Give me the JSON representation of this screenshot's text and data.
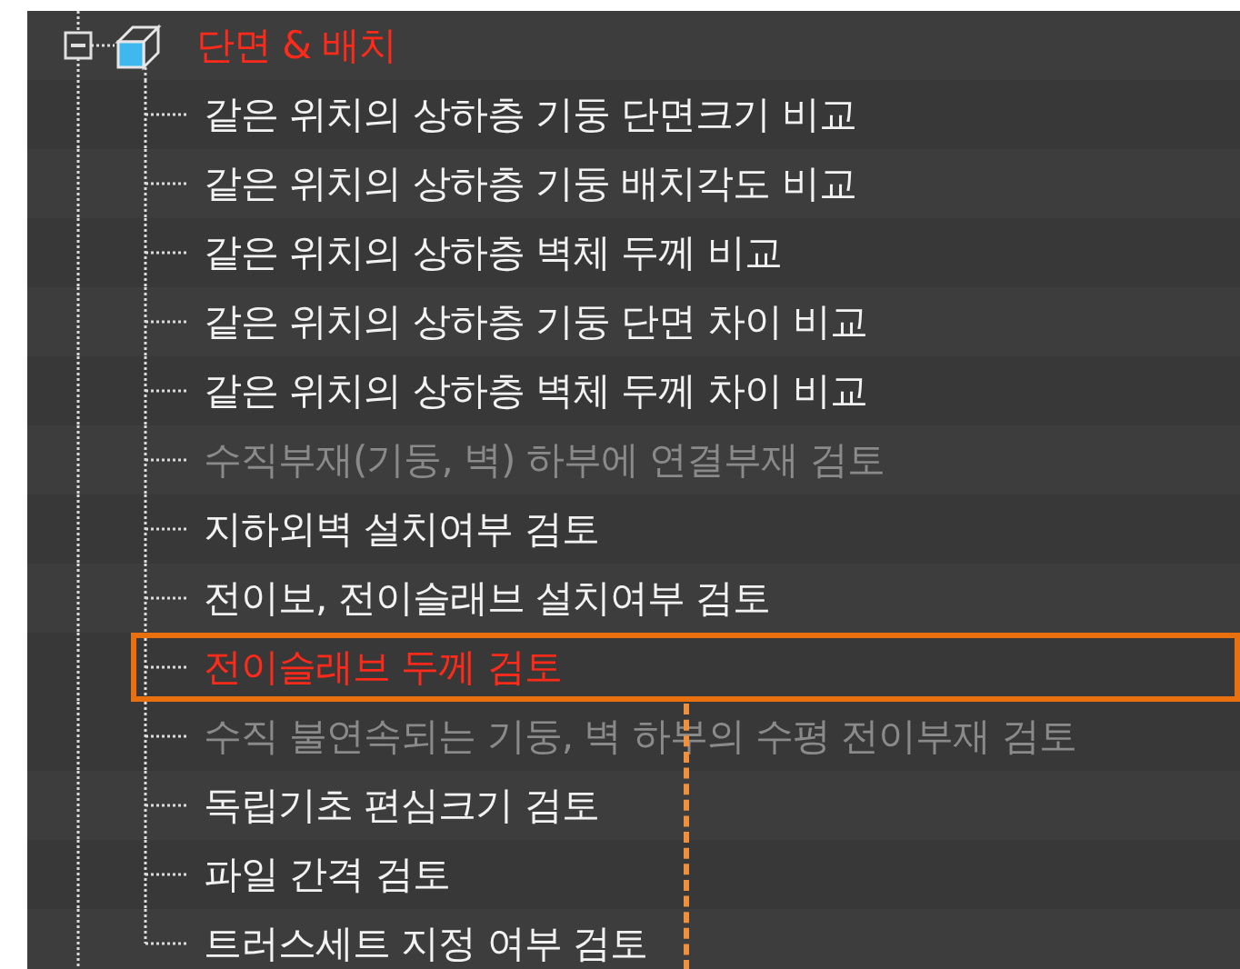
{
  "tree": {
    "label": "단면 & 배치",
    "expanded": true,
    "children": [
      {
        "label": "같은 위치의 상하층 기둥 단면크기 비교",
        "disabled": false,
        "highlighted": false
      },
      {
        "label": "같은 위치의 상하층 기둥 배치각도 비교",
        "disabled": false,
        "highlighted": false
      },
      {
        "label": "같은 위치의 상하층 벽체 두께 비교",
        "disabled": false,
        "highlighted": false
      },
      {
        "label": "같은 위치의 상하층 기둥 단면 차이 비교",
        "disabled": false,
        "highlighted": false
      },
      {
        "label": "같은 위치의 상하층 벽체 두께 차이 비교",
        "disabled": false,
        "highlighted": false
      },
      {
        "label": "수직부재(기둥, 벽) 하부에 연결부재 검토",
        "disabled": true,
        "highlighted": false
      },
      {
        "label": "지하외벽 설치여부 검토",
        "disabled": false,
        "highlighted": false
      },
      {
        "label": "전이보, 전이슬래브 설치여부 검토",
        "disabled": false,
        "highlighted": false
      },
      {
        "label": "전이슬래브 두께 검토",
        "disabled": false,
        "highlighted": true
      },
      {
        "label": "수직 불연속되는 기둥, 벽 하부의 수평 전이부재 검토",
        "disabled": true,
        "highlighted": false
      },
      {
        "label": "독립기초 편심크기 검토",
        "disabled": false,
        "highlighted": false
      },
      {
        "label": "파일 간격 검토",
        "disabled": false,
        "highlighted": false
      },
      {
        "label": "트러스세트 지정 여부 검토",
        "disabled": false,
        "highlighted": false
      }
    ]
  }
}
